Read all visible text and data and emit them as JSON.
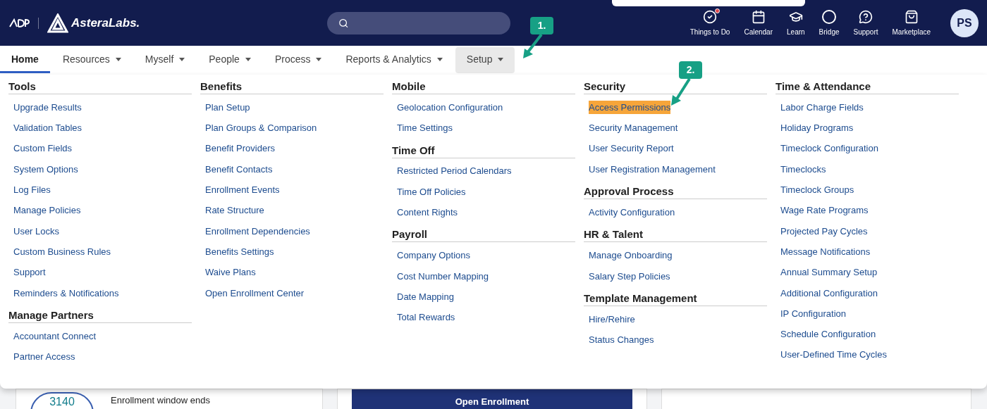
{
  "header": {
    "brand": "AsteraLabs.",
    "icons": [
      {
        "kind": "todo",
        "label": "Things to Do",
        "badge": true
      },
      {
        "kind": "calendar",
        "label": "Calendar",
        "badge": false
      },
      {
        "kind": "learn",
        "label": "Learn",
        "badge": false
      },
      {
        "kind": "bridge",
        "label": "Bridge",
        "badge": false
      },
      {
        "kind": "support",
        "label": "Support",
        "badge": false
      },
      {
        "kind": "marketplace",
        "label": "Marketplace",
        "badge": false
      }
    ],
    "avatar": "PS"
  },
  "nav": [
    {
      "label": "Home",
      "caret": false,
      "selected": true,
      "open": false
    },
    {
      "label": "Resources",
      "caret": true,
      "selected": false,
      "open": false
    },
    {
      "label": "Myself",
      "caret": true,
      "selected": false,
      "open": false
    },
    {
      "label": "People",
      "caret": true,
      "selected": false,
      "open": false
    },
    {
      "label": "Process",
      "caret": true,
      "selected": false,
      "open": false
    },
    {
      "label": "Reports & Analytics",
      "caret": true,
      "selected": false,
      "open": false
    },
    {
      "label": "Setup",
      "caret": true,
      "selected": false,
      "open": true
    }
  ],
  "menu": [
    [
      {
        "title": "Tools",
        "items": [
          {
            "label": "Upgrade Results",
            "highlighted": false
          },
          {
            "label": "Validation Tables",
            "highlighted": false
          },
          {
            "label": "Custom Fields",
            "highlighted": false
          },
          {
            "label": "System Options",
            "highlighted": false
          },
          {
            "label": "Log Files",
            "highlighted": false
          },
          {
            "label": "Manage Policies",
            "highlighted": false
          },
          {
            "label": "User Locks",
            "highlighted": false
          },
          {
            "label": "Custom Business Rules",
            "highlighted": false
          },
          {
            "label": "Support",
            "highlighted": false
          },
          {
            "label": "Reminders & Notifications",
            "highlighted": false
          }
        ]
      },
      {
        "title": "Manage Partners",
        "items": [
          {
            "label": "Accountant Connect",
            "highlighted": false
          },
          {
            "label": "Partner Access",
            "highlighted": false
          }
        ]
      }
    ],
    [
      {
        "title": "Benefits",
        "items": [
          {
            "label": "Plan Setup",
            "highlighted": false
          },
          {
            "label": "Plan Groups & Comparison",
            "highlighted": false
          },
          {
            "label": "Benefit Providers",
            "highlighted": false
          },
          {
            "label": "Benefit Contacts",
            "highlighted": false
          },
          {
            "label": "Enrollment Events",
            "highlighted": false
          },
          {
            "label": "Rate Structure",
            "highlighted": false
          },
          {
            "label": "Enrollment Dependencies",
            "highlighted": false
          },
          {
            "label": "Benefits Settings",
            "highlighted": false
          },
          {
            "label": "Waive Plans",
            "highlighted": false
          },
          {
            "label": "Open Enrollment Center",
            "highlighted": false
          }
        ]
      }
    ],
    [
      {
        "title": "Mobile",
        "items": [
          {
            "label": "Geolocation Configuration",
            "highlighted": false
          },
          {
            "label": "Time Settings",
            "highlighted": false
          }
        ]
      },
      {
        "title": "Time Off",
        "items": [
          {
            "label": "Restricted Period Calendars",
            "highlighted": false
          },
          {
            "label": "Time Off Policies",
            "highlighted": false
          },
          {
            "label": "Content Rights",
            "highlighted": false
          }
        ]
      },
      {
        "title": "Payroll",
        "items": [
          {
            "label": "Company Options",
            "highlighted": false
          },
          {
            "label": "Cost Number Mapping",
            "highlighted": false
          },
          {
            "label": "Date Mapping",
            "highlighted": false
          },
          {
            "label": "Total Rewards",
            "highlighted": false
          }
        ]
      }
    ],
    [
      {
        "title": "Security",
        "items": [
          {
            "label": "Access Permissions",
            "highlighted": true
          },
          {
            "label": "Security Management",
            "highlighted": false
          },
          {
            "label": "User Security Report",
            "highlighted": false
          },
          {
            "label": "User Registration Management",
            "highlighted": false
          }
        ]
      },
      {
        "title": "Approval Process",
        "items": [
          {
            "label": "Activity Configuration",
            "highlighted": false
          }
        ]
      },
      {
        "title": "HR & Talent",
        "items": [
          {
            "label": "Manage Onboarding",
            "highlighted": false
          },
          {
            "label": "Salary Step Policies",
            "highlighted": false
          }
        ]
      },
      {
        "title": "Template Management",
        "items": [
          {
            "label": "Hire/Rehire",
            "highlighted": false
          },
          {
            "label": "Status Changes",
            "highlighted": false
          }
        ]
      }
    ],
    [
      {
        "title": "Time & Attendance",
        "items": [
          {
            "label": "Labor Charge Fields",
            "highlighted": false
          },
          {
            "label": "Holiday Programs",
            "highlighted": false
          },
          {
            "label": "Timeclock Configuration",
            "highlighted": false
          },
          {
            "label": "Timeclocks",
            "highlighted": false
          },
          {
            "label": "Timeclock Groups",
            "highlighted": false
          },
          {
            "label": "Wage Rate Programs",
            "highlighted": false
          },
          {
            "label": "Projected Pay Cycles",
            "highlighted": false
          },
          {
            "label": "Message Notifications",
            "highlighted": false
          },
          {
            "label": "Annual Summary Setup",
            "highlighted": false
          },
          {
            "label": "Additional Configuration",
            "highlighted": false
          },
          {
            "label": "IP Configuration",
            "highlighted": false
          },
          {
            "label": "Schedule Configuration",
            "highlighted": false
          },
          {
            "label": "User-Defined Time Cycles",
            "highlighted": false
          }
        ]
      }
    ]
  ],
  "callouts": [
    "1.",
    "2."
  ],
  "cards": {
    "count": "3140",
    "enrollment_text": "Enrollment window ends",
    "banner": "Open Enrollment"
  }
}
